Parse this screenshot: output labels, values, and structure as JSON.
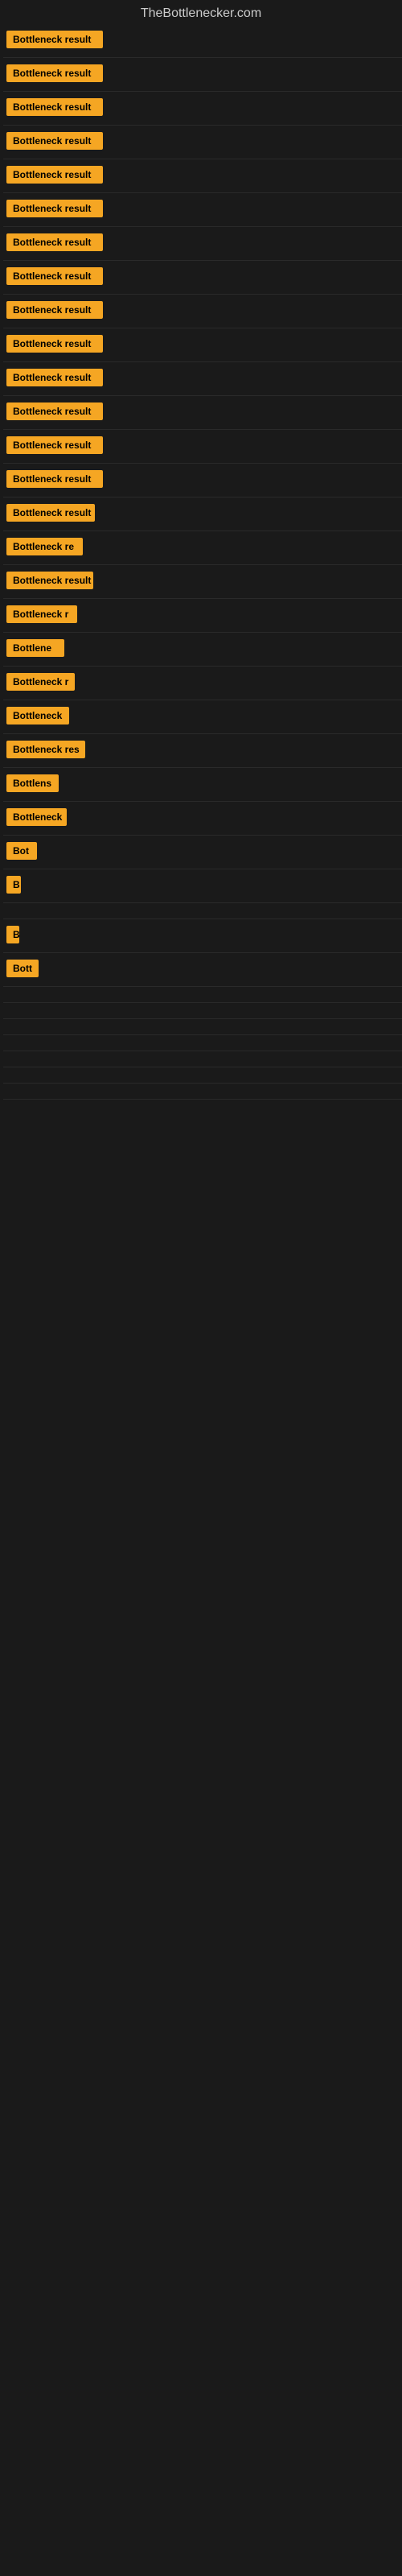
{
  "site": {
    "title": "TheBottlenecker.com"
  },
  "items": [
    {
      "label": "Bottleneck result",
      "width": 120
    },
    {
      "label": "Bottleneck result",
      "width": 120
    },
    {
      "label": "Bottleneck result",
      "width": 120
    },
    {
      "label": "Bottleneck result",
      "width": 120
    },
    {
      "label": "Bottleneck result",
      "width": 120
    },
    {
      "label": "Bottleneck result",
      "width": 120
    },
    {
      "label": "Bottleneck result",
      "width": 120
    },
    {
      "label": "Bottleneck result",
      "width": 120
    },
    {
      "label": "Bottleneck result",
      "width": 120
    },
    {
      "label": "Bottleneck result",
      "width": 120
    },
    {
      "label": "Bottleneck result",
      "width": 120
    },
    {
      "label": "Bottleneck result",
      "width": 120
    },
    {
      "label": "Bottleneck result",
      "width": 120
    },
    {
      "label": "Bottleneck result",
      "width": 120
    },
    {
      "label": "Bottleneck result",
      "width": 110
    },
    {
      "label": "Bottleneck re",
      "width": 95
    },
    {
      "label": "Bottleneck result",
      "width": 108
    },
    {
      "label": "Bottleneck r",
      "width": 88
    },
    {
      "label": "Bottlene",
      "width": 72
    },
    {
      "label": "Bottleneck r",
      "width": 85
    },
    {
      "label": "Bottleneck",
      "width": 78
    },
    {
      "label": "Bottleneck res",
      "width": 98
    },
    {
      "label": "Bottlens",
      "width": 65
    },
    {
      "label": "Bottleneck",
      "width": 75
    },
    {
      "label": "Bot",
      "width": 38
    },
    {
      "label": "B",
      "width": 18
    },
    {
      "label": "",
      "width": 0
    },
    {
      "label": "B",
      "width": 16
    },
    {
      "label": "Bott",
      "width": 40
    },
    {
      "label": "",
      "width": 0
    },
    {
      "label": "",
      "width": 0
    },
    {
      "label": "",
      "width": 0
    },
    {
      "label": "",
      "width": 0
    },
    {
      "label": "",
      "width": 0
    },
    {
      "label": "",
      "width": 0
    },
    {
      "label": "",
      "width": 0
    }
  ]
}
